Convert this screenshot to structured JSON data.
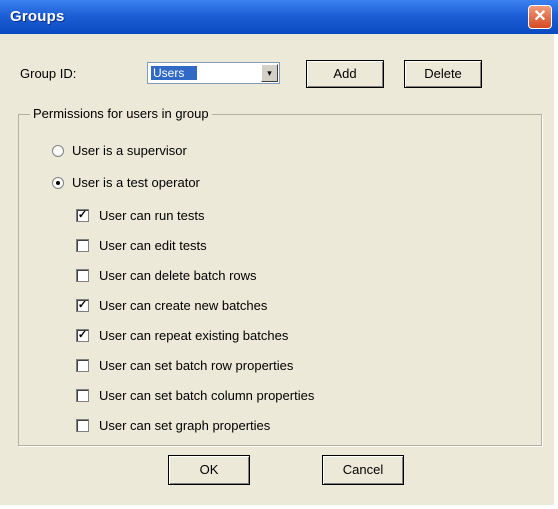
{
  "window": {
    "title": "Groups",
    "close_glyph": "✕"
  },
  "group_id": {
    "label": "Group ID:",
    "value": "Users",
    "dropdown_glyph": "▾"
  },
  "buttons": {
    "add": "Add",
    "delete": "Delete",
    "ok": "OK",
    "cancel": "Cancel"
  },
  "permissions": {
    "title": "Permissions for users in group",
    "roles": [
      {
        "label": "User is a supervisor",
        "selected": false
      },
      {
        "label": "User is a test operator",
        "selected": true
      }
    ],
    "items": [
      {
        "label": "User can run tests",
        "checked": true
      },
      {
        "label": "User can edit tests",
        "checked": false
      },
      {
        "label": "User can delete batch rows",
        "checked": false
      },
      {
        "label": "User can create new batches",
        "checked": true
      },
      {
        "label": "User can repeat existing batches",
        "checked": true
      },
      {
        "label": "User can set batch row properties",
        "checked": false
      },
      {
        "label": "User can set batch column properties",
        "checked": false
      },
      {
        "label": "User can set graph properties",
        "checked": false
      }
    ]
  }
}
